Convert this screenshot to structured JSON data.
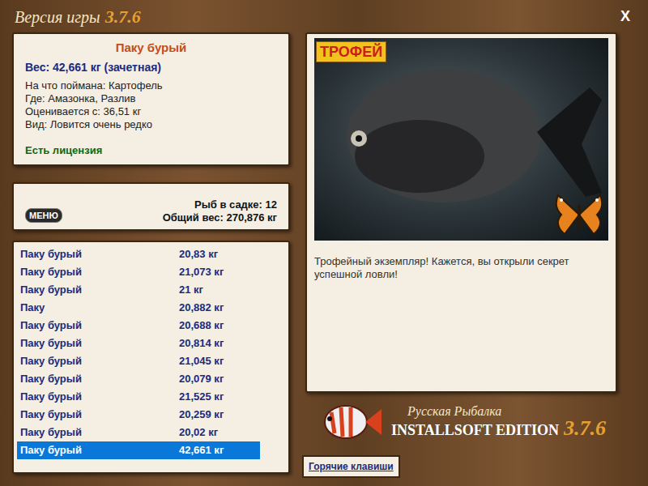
{
  "window": {
    "title": "Версия игры",
    "version": "3.7.6",
    "close": "X"
  },
  "catch": {
    "name": "Паку бурый",
    "weight": "Вес: 42,661 кг (зачетная)",
    "details": [
      "На что поймана: Картофель",
      "Где: Амазонка, Разлив",
      "Оценивается с: 36,51 кг",
      "Вид: Ловится очень редко"
    ],
    "license": "Есть лицензия"
  },
  "keepnet": {
    "menu": "МЕНЮ",
    "count": "Рыб в садке: 12",
    "total": "Общий вес: 270,876 кг"
  },
  "fish": [
    {
      "name": "Паку бурый",
      "weight": "20,83 кг",
      "selected": false
    },
    {
      "name": "Паку бурый",
      "weight": "21,073 кг",
      "selected": false
    },
    {
      "name": "Паку бурый",
      "weight": "21 кг",
      "selected": false
    },
    {
      "name": "Паку",
      "weight": "20,882 кг",
      "selected": false
    },
    {
      "name": "Паку бурый",
      "weight": "20,688 кг",
      "selected": false
    },
    {
      "name": "Паку бурый",
      "weight": "20,814 кг",
      "selected": false
    },
    {
      "name": "Паку бурый",
      "weight": "21,045 кг",
      "selected": false
    },
    {
      "name": "Паку бурый",
      "weight": "20,079 кг",
      "selected": false
    },
    {
      "name": "Паку бурый",
      "weight": "21,525 кг",
      "selected": false
    },
    {
      "name": "Паку бурый",
      "weight": "20,259 кг",
      "selected": false
    },
    {
      "name": "Паку бурый",
      "weight": "20,02 кг",
      "selected": false
    },
    {
      "name": "Паку бурый",
      "weight": "42,661 кг",
      "selected": true
    }
  ],
  "photo": {
    "badge": "ТРОФЕЙ"
  },
  "message": "Трофейный экземпляр! Кажется, вы открыли секрет успешной ловли!",
  "logo": {
    "title": "Русская Рыбалка",
    "edition": "INSTALLSOFT EDITION",
    "version": "3.7.6"
  },
  "hotkeys": "Горячие клавиши"
}
